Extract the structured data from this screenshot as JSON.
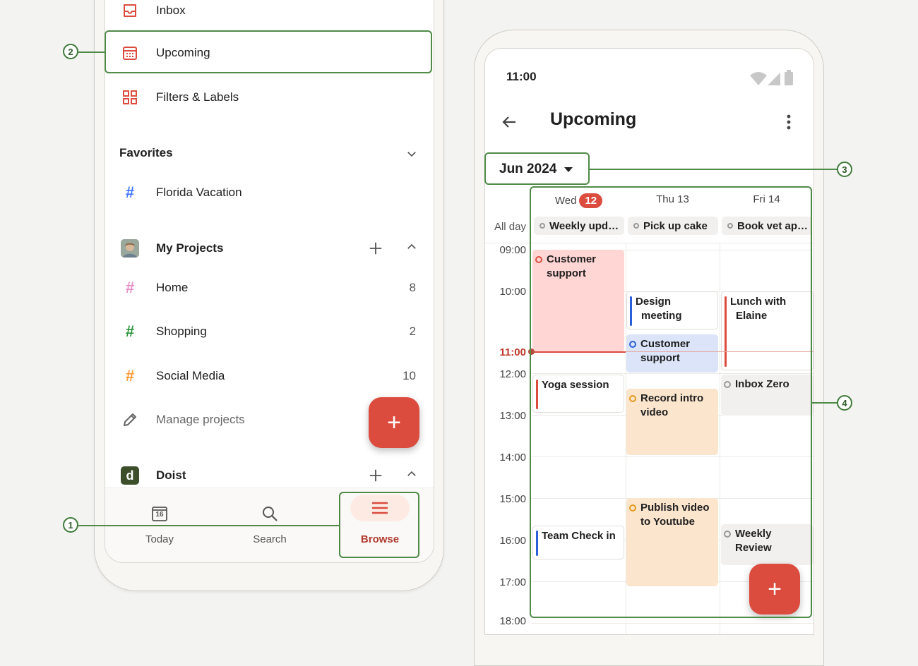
{
  "left": {
    "nav": [
      {
        "label": "Inbox"
      },
      {
        "label": "Upcoming"
      },
      {
        "label": "Filters & Labels"
      }
    ],
    "favorites": {
      "title": "Favorites",
      "items": [
        {
          "label": "Florida Vacation",
          "color": "#4073ff"
        }
      ]
    },
    "my_projects": {
      "title": "My Projects",
      "items": [
        {
          "label": "Home",
          "count": "8",
          "color": "#e78ec6"
        },
        {
          "label": "Shopping",
          "count": "2",
          "color": "#299438"
        },
        {
          "label": "Social Media",
          "count": "10",
          "color": "#ff9933"
        }
      ],
      "manage_label": "Manage projects"
    },
    "doist": {
      "title": "Doist",
      "avatar_letter": "d"
    },
    "tabs": [
      {
        "label": "Today",
        "badge": "16"
      },
      {
        "label": "Search"
      },
      {
        "label": "Browse"
      }
    ],
    "fab": "+"
  },
  "right": {
    "status_time": "11:00",
    "title": "Upcoming",
    "month": "Jun 2024",
    "days": [
      {
        "label": "Wed",
        "badge": "12"
      },
      {
        "label": "Thu 13"
      },
      {
        "label": "Fri 14"
      }
    ],
    "allday_label": "All day",
    "allday": [
      "Weekly upd…",
      "Pick up cake",
      "Book vet ap…"
    ],
    "hours": [
      "09:00",
      "10:00",
      "11:00",
      "12:00",
      "13:00",
      "14:00",
      "15:00",
      "16:00",
      "17:00",
      "18:00"
    ],
    "events": {
      "wed_support": "Customer support",
      "wed_yoga": "Yoga session",
      "wed_team": "Team Check in",
      "thu_design": "Design meeting",
      "thu_support": "Customer support",
      "thu_record": "Record intro video",
      "thu_publish": "Publish video to Youtube",
      "fri_lunch": "Lunch with Elaine",
      "fri_inbox": "Inbox Zero",
      "fri_weekly": "Weekly Review"
    },
    "fab": "+"
  },
  "callouts": [
    "1",
    "2",
    "3",
    "4"
  ],
  "colors": {
    "accent": "#dc4c3e",
    "callout": "#4f8a47"
  }
}
